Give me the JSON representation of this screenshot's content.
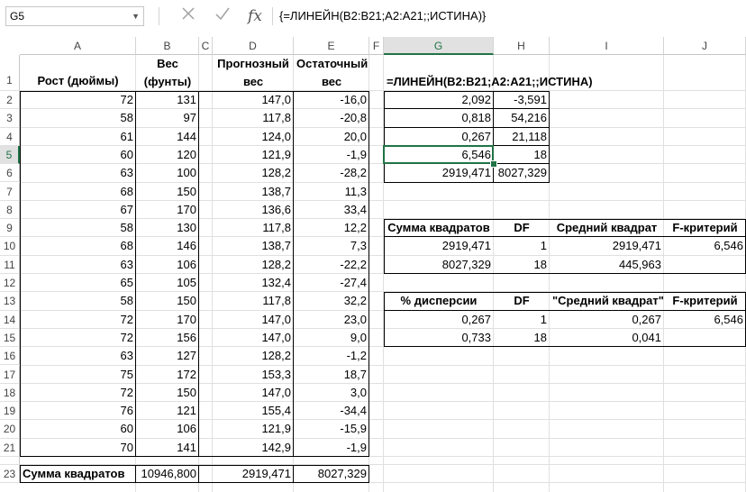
{
  "formula_bar": {
    "name_box": "G5",
    "formula": "{=ЛИНЕЙН(B2:B21;A2:A21;;ИСТИНА)}",
    "icons": [
      "dropdown-icon",
      "cancel-icon",
      "enter-icon",
      "fx-icon"
    ]
  },
  "columns": [
    "A",
    "B",
    "C",
    "D",
    "E",
    "F",
    "G",
    "H",
    "I",
    "J"
  ],
  "rows": [
    "1",
    "2",
    "3",
    "4",
    "5",
    "6",
    "7",
    "8",
    "9",
    "10",
    "11",
    "12",
    "13",
    "14",
    "15",
    "16",
    "17",
    "18",
    "19",
    "20",
    "21",
    "22",
    "23"
  ],
  "active_cell": "G5",
  "headers": {
    "a1": "Рост (дюймы)",
    "b1_line1": "Вес",
    "b1_line2": "(фунты)",
    "d1_line1": "Прогнозный",
    "d1_line2": "вес",
    "e1_line1": "Остаточный",
    "e1_line2": "вес",
    "g1": "=ЛИНЕЙН(B2:B21;A2:A21;;ИСТИНА)"
  },
  "data_rows": [
    {
      "a": "72",
      "b": "131",
      "d": "147,0",
      "e": "-16,0"
    },
    {
      "a": "58",
      "b": "97",
      "d": "117,8",
      "e": "-20,8"
    },
    {
      "a": "61",
      "b": "144",
      "d": "124,0",
      "e": "20,0"
    },
    {
      "a": "60",
      "b": "120",
      "d": "121,9",
      "e": "-1,9"
    },
    {
      "a": "63",
      "b": "100",
      "d": "128,2",
      "e": "-28,2"
    },
    {
      "a": "68",
      "b": "150",
      "d": "138,7",
      "e": "11,3"
    },
    {
      "a": "67",
      "b": "170",
      "d": "136,6",
      "e": "33,4"
    },
    {
      "a": "58",
      "b": "130",
      "d": "117,8",
      "e": "12,2"
    },
    {
      "a": "68",
      "b": "146",
      "d": "138,7",
      "e": "7,3"
    },
    {
      "a": "63",
      "b": "106",
      "d": "128,2",
      "e": "-22,2"
    },
    {
      "a": "65",
      "b": "105",
      "d": "132,4",
      "e": "-27,4"
    },
    {
      "a": "58",
      "b": "150",
      "d": "117,8",
      "e": "32,2"
    },
    {
      "a": "72",
      "b": "170",
      "d": "147,0",
      "e": "23,0"
    },
    {
      "a": "72",
      "b": "156",
      "d": "147,0",
      "e": "9,0"
    },
    {
      "a": "63",
      "b": "127",
      "d": "128,2",
      "e": "-1,2"
    },
    {
      "a": "75",
      "b": "172",
      "d": "153,3",
      "e": "18,7"
    },
    {
      "a": "72",
      "b": "150",
      "d": "147,0",
      "e": "3,0"
    },
    {
      "a": "76",
      "b": "121",
      "d": "155,4",
      "e": "-34,4"
    },
    {
      "a": "60",
      "b": "106",
      "d": "121,9",
      "e": "-15,9"
    },
    {
      "a": "70",
      "b": "141",
      "d": "142,9",
      "e": "-1,9"
    }
  ],
  "linest": [
    {
      "g": "2,092",
      "h": "-3,591"
    },
    {
      "g": "0,818",
      "h": "54,216"
    },
    {
      "g": "0,267",
      "h": "21,118"
    },
    {
      "g": "6,546",
      "h": "18"
    },
    {
      "g": "2919,471",
      "h": "8027,329"
    }
  ],
  "anova1": {
    "headers": [
      "Сумма квадратов",
      "DF",
      "Средний квадрат",
      "F-критерий"
    ],
    "rows": [
      [
        "2919,471",
        "1",
        "2919,471",
        "6,546"
      ],
      [
        "8027,329",
        "18",
        "445,963",
        ""
      ]
    ]
  },
  "anova2": {
    "headers": [
      "% дисперсии",
      "DF",
      "\"Средний квадрат\"",
      "F-критерий"
    ],
    "rows": [
      [
        "0,267",
        "1",
        "0,267",
        "6,546"
      ],
      [
        "0,733",
        "18",
        "0,041",
        ""
      ]
    ]
  },
  "totals": {
    "label": "Сумма квадратов",
    "b": "10946,800",
    "d": "2919,471",
    "e": "8027,329"
  }
}
